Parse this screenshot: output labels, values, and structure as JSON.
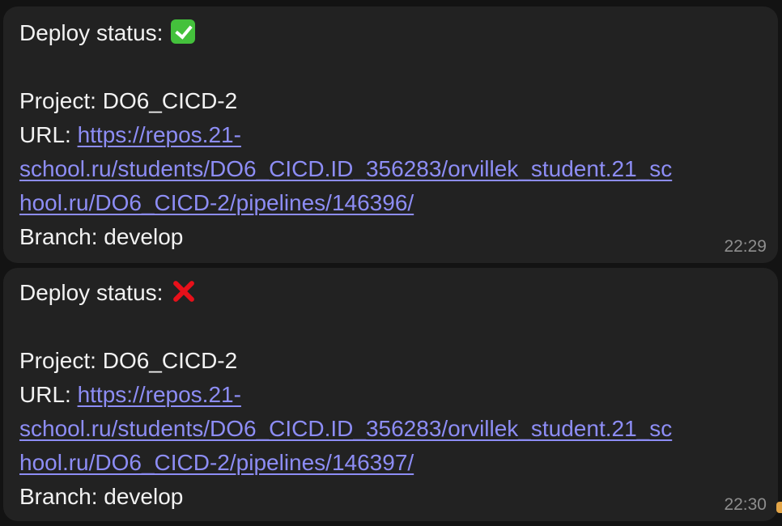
{
  "messages": [
    {
      "status_label": "Deploy status:",
      "status_icon": "check-mark-icon",
      "project_label": "Project:",
      "project_value": "DO6_CICD-2",
      "url_label": "URL:",
      "url_line1": "https://repos.21-",
      "url_line2": "school.ru/students/DO6_CICD.ID_356283/orvillek_student.21_sc",
      "url_line3": "hool.ru/DO6_CICD-2/pipelines/146396/",
      "branch_label": "Branch:",
      "branch_value": "develop",
      "time": "22:29"
    },
    {
      "status_label": "Deploy status:",
      "status_icon": "cross-mark-icon",
      "project_label": "Project:",
      "project_value": "DO6_CICD-2",
      "url_label": "URL:",
      "url_line1": "https://repos.21-",
      "url_line2": "school.ru/students/DO6_CICD.ID_356283/orvillek_student.21_sc",
      "url_line3": "hool.ru/DO6_CICD-2/pipelines/146397/",
      "branch_label": "Branch:",
      "branch_value": "develop",
      "time": "22:30"
    }
  ],
  "colors": {
    "bubble": "#222222",
    "text": "#f2f2f2",
    "link": "#8d8df5",
    "time": "#8e8e8e",
    "success": "#44c13c",
    "failure": "#e8101a"
  }
}
